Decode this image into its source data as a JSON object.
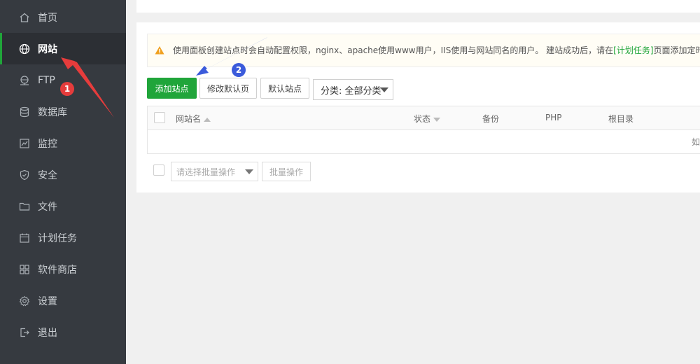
{
  "sidebar": {
    "items": [
      {
        "label": "首页",
        "icon": "home-icon"
      },
      {
        "label": "网站",
        "icon": "globe-icon",
        "active": true
      },
      {
        "label": "FTP",
        "icon": "ftp-icon"
      },
      {
        "label": "数据库",
        "icon": "database-icon"
      },
      {
        "label": "监控",
        "icon": "monitor-icon"
      },
      {
        "label": "安全",
        "icon": "shield-icon"
      },
      {
        "label": "文件",
        "icon": "folder-icon"
      },
      {
        "label": "计划任务",
        "icon": "calendar-icon"
      },
      {
        "label": "软件商店",
        "icon": "apps-icon"
      },
      {
        "label": "设置",
        "icon": "gear-icon"
      },
      {
        "label": "退出",
        "icon": "logout-icon"
      }
    ]
  },
  "notice": {
    "text_before": "使用面板创建站点时会自动配置权限，nginx、apache使用www用户，IIS使用与网站同名的用户。 建站成功后，请在",
    "link": "[计划任务]",
    "text_after": "页面添加定时备份任务"
  },
  "toolbar": {
    "add_site": "添加站点",
    "modify_default": "修改默认页",
    "default_site": "默认站点",
    "category_select": "分类: 全部分类"
  },
  "table": {
    "columns": [
      "网站名",
      "状态",
      "备份",
      "PHP",
      "根目录"
    ],
    "empty_fragment": "如"
  },
  "batch": {
    "select_placeholder": "请选择批量操作",
    "button": "批量操作"
  },
  "annotations": {
    "badge1": "1",
    "badge2": "2"
  },
  "colors": {
    "accent_green": "#20a53a",
    "sidebar_bg": "#363a40",
    "annotation_red": "#e63c3c",
    "annotation_blue": "#3b5bdb"
  }
}
